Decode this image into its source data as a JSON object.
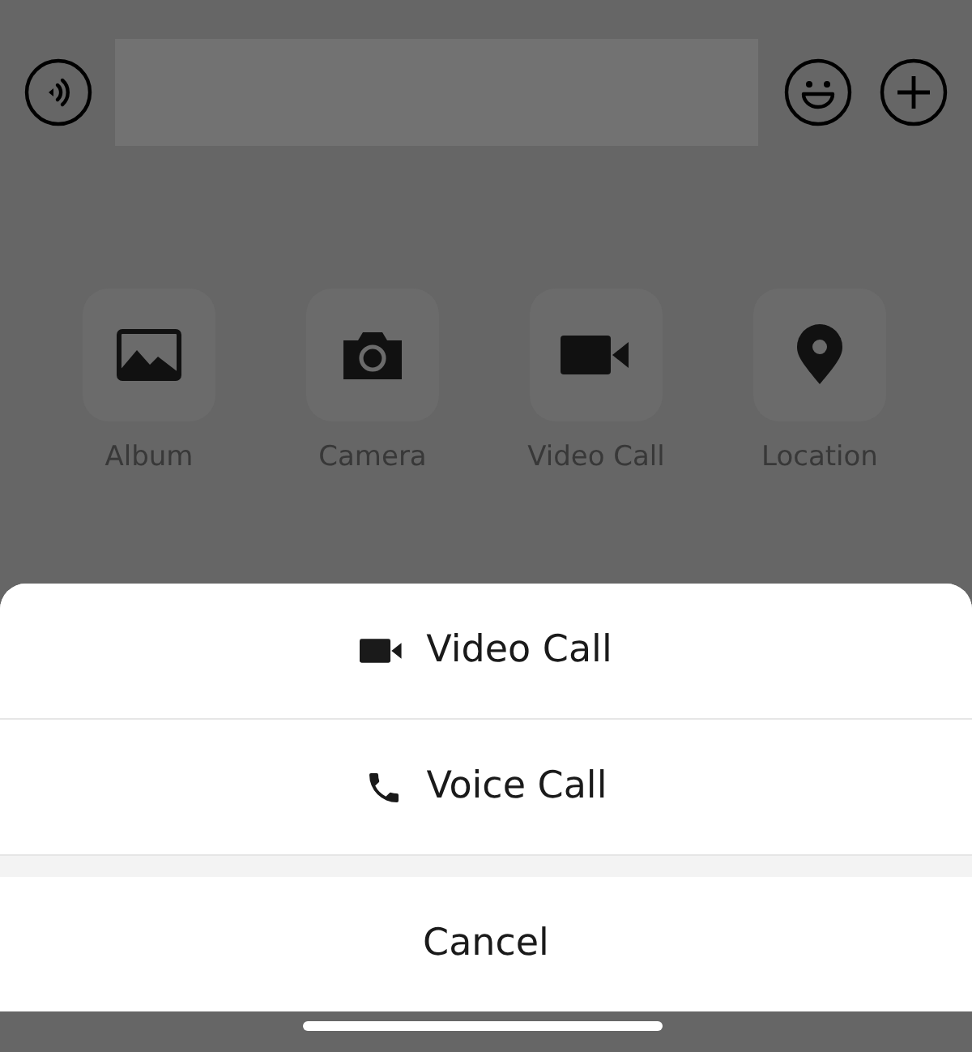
{
  "input_bar": {
    "left_button": {
      "kind": "voice"
    },
    "right_buttons": [
      {
        "kind": "emoji"
      },
      {
        "kind": "plus"
      }
    ]
  },
  "panel": {
    "items": [
      {
        "kind": "album",
        "label": "Album"
      },
      {
        "kind": "camera",
        "label": "Camera"
      },
      {
        "kind": "video",
        "label": "Video Call"
      },
      {
        "kind": "location",
        "label": "Location"
      }
    ]
  },
  "action_sheet": {
    "actions": [
      {
        "kind": "video",
        "label": "Video Call"
      },
      {
        "kind": "voice",
        "label": "Voice Call"
      }
    ],
    "cancel": "Cancel"
  }
}
